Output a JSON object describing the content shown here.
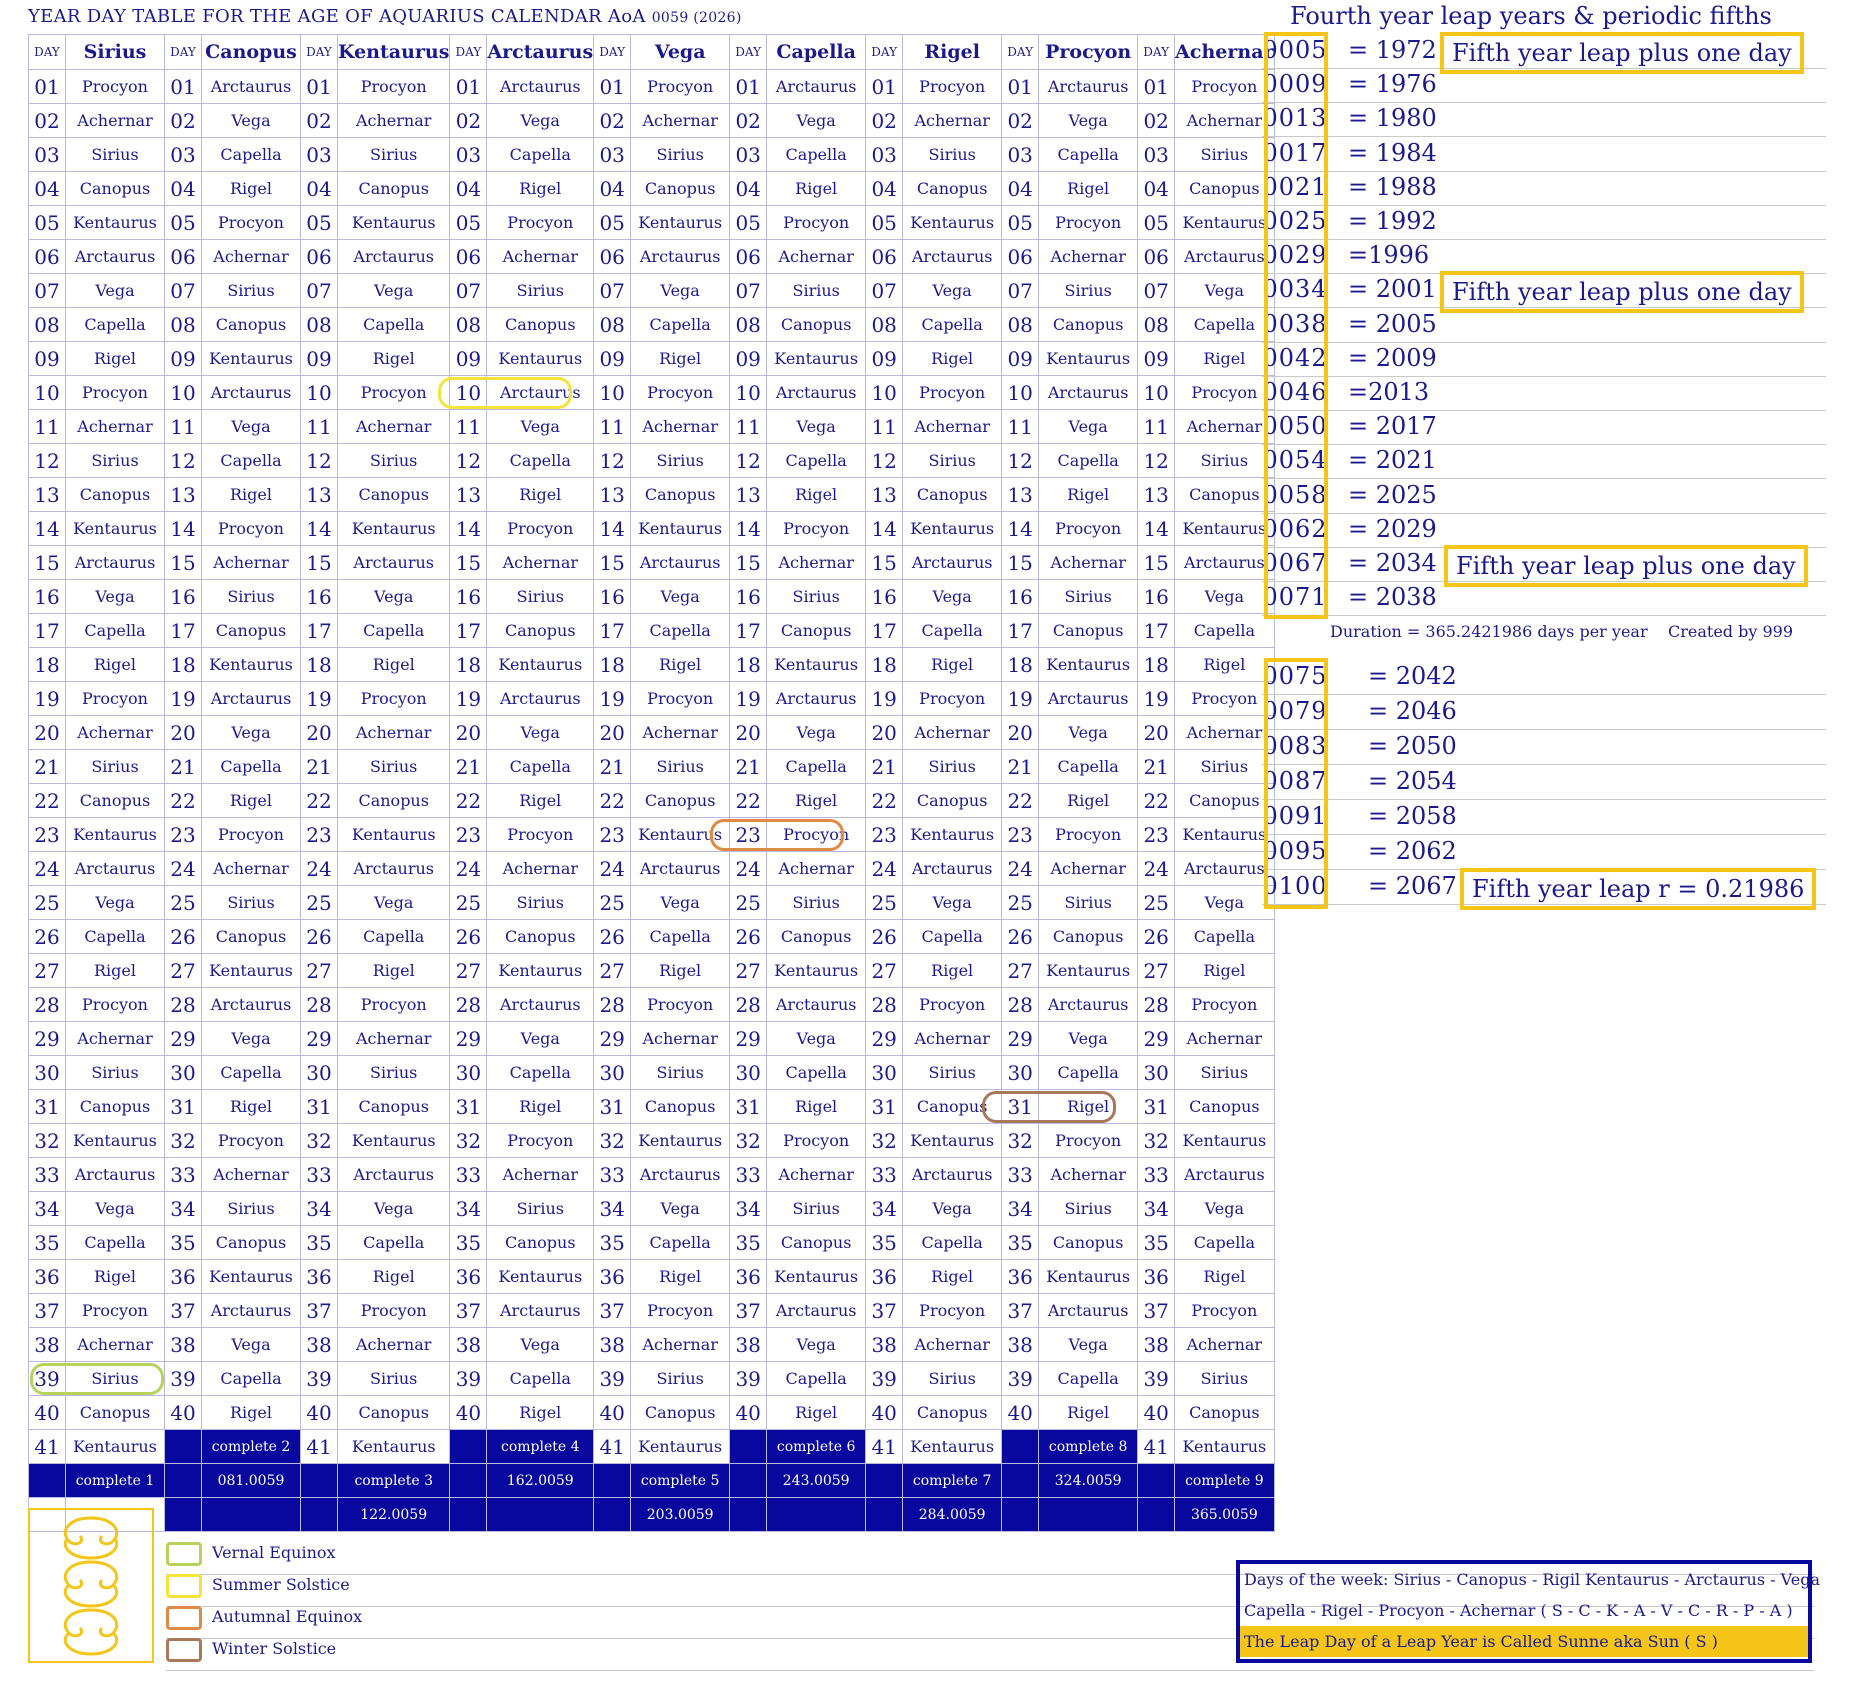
{
  "title": {
    "main": "YEAR DAY TABLE FOR THE AGE OF AQUARIUS CALENDAR  AoA",
    "suffix": "0059 (2026)"
  },
  "table": {
    "day_label": "DAY",
    "months": [
      "Sirius",
      "Canopus",
      "Kentaurus",
      "Arctaurus",
      "Vega",
      "Capella",
      "Rigel",
      "Procyon",
      "Achernar"
    ],
    "day_numbers": [
      "01",
      "02",
      "03",
      "04",
      "05",
      "06",
      "07",
      "08",
      "09",
      "10",
      "11",
      "12",
      "13",
      "14",
      "15",
      "16",
      "17",
      "18",
      "19",
      "20",
      "21",
      "22",
      "23",
      "24",
      "25",
      "26",
      "27",
      "28",
      "29",
      "30",
      "31",
      "32",
      "33",
      "34",
      "35",
      "36",
      "37",
      "38",
      "39",
      "40",
      "41"
    ],
    "odd_cycle": [
      "Procyon",
      "Achernar",
      "Sirius",
      "Canopus",
      "Kentaurus",
      "Arctaurus",
      "Vega",
      "Capella",
      "Rigel"
    ],
    "even_cycle": [
      "Arctaurus",
      "Vega",
      "Capella",
      "Rigel",
      "Procyon",
      "Achernar",
      "Sirius",
      "Canopus",
      "Kentaurus"
    ],
    "completions": [
      {
        "label": "complete 1",
        "date": ""
      },
      {
        "label": "complete 2",
        "date": "081.0059"
      },
      {
        "label": "complete 3",
        "date": "122.0059"
      },
      {
        "label": "complete 4",
        "date": "162.0059"
      },
      {
        "label": "complete 5",
        "date": "203.0059"
      },
      {
        "label": "complete 6",
        "date": "243.0059"
      },
      {
        "label": "complete 7",
        "date": "284.0059"
      },
      {
        "label": "complete 8",
        "date": "324.0059"
      },
      {
        "label": "complete 9",
        "date": "365.0059"
      }
    ]
  },
  "colors": {
    "vernal": "#b7d35a",
    "summer": "#f5e33a",
    "autumnal": "#e08a45",
    "winter": "#a8785a",
    "navy": "#08089e",
    "gold": "#f5c518",
    "text": "#1b1a8c"
  },
  "right": {
    "title": "Fourth year leap years & periodic fifths",
    "group1": [
      {
        "code": "0005",
        "eq": "= 1972",
        "note": "Fifth year leap plus one day"
      },
      {
        "code": "0009",
        "eq": "= 1976"
      },
      {
        "code": "0013",
        "eq": "= 1980"
      },
      {
        "code": "0017",
        "eq": "= 1984"
      },
      {
        "code": "0021",
        "eq": "= 1988"
      },
      {
        "code": "0025",
        "eq": "= 1992"
      },
      {
        "code": "0029",
        "eq": "=1996"
      },
      {
        "code": "0034",
        "eq": "= 2001",
        "note": "Fifth year leap plus one day"
      },
      {
        "code": "0038",
        "eq": "= 2005"
      },
      {
        "code": "0042",
        "eq": "= 2009"
      },
      {
        "code": "0046",
        "eq": "=2013"
      },
      {
        "code": "0050",
        "eq": "= 2017"
      },
      {
        "code": "0054",
        "eq": "= 2021"
      },
      {
        "code": "0058",
        "eq": "= 2025"
      },
      {
        "code": "0062",
        "eq": "= 2029"
      },
      {
        "code": "0067",
        "eq": "= 2034",
        "note": "Fifth year leap plus one day"
      },
      {
        "code": "0071",
        "eq": "= 2038"
      }
    ],
    "duration": "Duration = 365.2421986 days per year",
    "created": "Created by 999",
    "group2": [
      {
        "code": "0075",
        "eq": "=  2042"
      },
      {
        "code": "0079",
        "eq": "=  2046"
      },
      {
        "code": "0083",
        "eq": "=  2050"
      },
      {
        "code": "0087",
        "eq": "=  2054"
      },
      {
        "code": "0091",
        "eq": "=  2058"
      },
      {
        "code": "0095",
        "eq": "=  2062"
      },
      {
        "code": "0100",
        "eq": "=  2067",
        "note": "Fifth year leap r = 0.21986"
      }
    ]
  },
  "legend": [
    {
      "label": "Vernal Equinox",
      "color": "#b7d35a"
    },
    {
      "label": "Summer Solstice",
      "color": "#f5e33a"
    },
    {
      "label": "Autumnal Equinox",
      "color": "#e08a45"
    },
    {
      "label": "Winter Solstice",
      "color": "#a8785a"
    }
  ],
  "week_box": {
    "line1": "Days of the week:  Sirius - Canopus - Rigil Kentaurus - Arctaurus - Vega",
    "line2": "Capella - Rigel - Procyon - Achernar ( S - C - K - A - V - C - R - P - A )",
    "line3": "The Leap Day of a Leap Year is Called Sunne aka Sun ( S )"
  }
}
